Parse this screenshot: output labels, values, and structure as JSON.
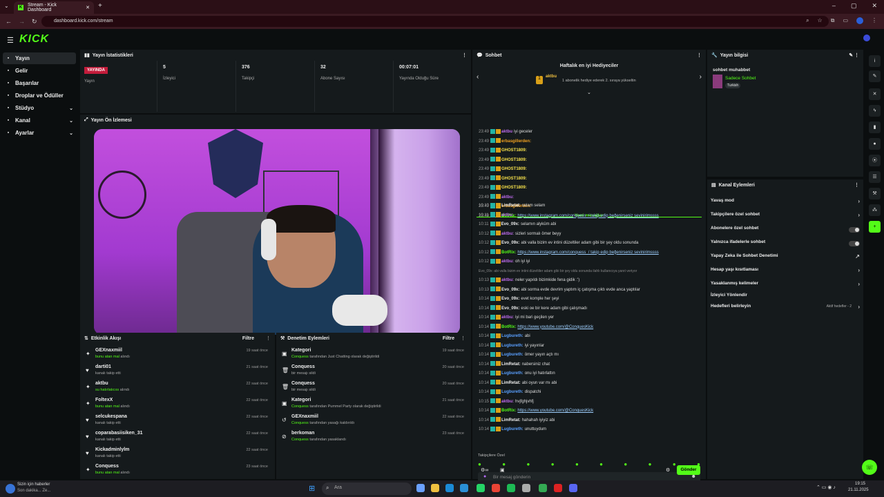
{
  "browser": {
    "tab_title": "Stream - Kick Dashboard",
    "url": "dashboard.kick.com/stream",
    "new_tab": "+",
    "window_controls": [
      "–",
      "▢",
      "✕"
    ]
  },
  "brand": {
    "logo": "KICK",
    "accent": "#53fc18",
    "live": "#c31c3b"
  },
  "sidebar": {
    "items": [
      {
        "label": "Yayın",
        "icon": "broadcast-icon",
        "active": true
      },
      {
        "label": "Gelir",
        "icon": "revenue-icon"
      },
      {
        "label": "Başarılar",
        "icon": "achievements-icon"
      },
      {
        "label": "Droplar ve Ödüller",
        "icon": "drops-icon"
      },
      {
        "label": "Stüdyo",
        "icon": "studio-icon",
        "chevron": "⌄"
      },
      {
        "label": "Kanal",
        "icon": "channel-icon",
        "chevron": "⌄"
      },
      {
        "label": "Ayarlar",
        "icon": "settings-icon",
        "chevron": "⌄"
      }
    ]
  },
  "stats": {
    "title": "Yayın İstatistikleri",
    "items": [
      {
        "value": "YAYINDA",
        "label": "Yayın",
        "badge": true
      },
      {
        "value": "5",
        "label": "İzleyici"
      },
      {
        "value": "376",
        "label": "Takipçi"
      },
      {
        "value": "32",
        "label": "Abone Sayısı"
      },
      {
        "value": "00:07:01",
        "label": "Yayında Olduğu Süre"
      }
    ]
  },
  "preview": {
    "title": "Yayın Ön İzlemesi"
  },
  "activity": {
    "title": "Etkinlik Akışı",
    "filter": "Filtre",
    "rows": [
      {
        "name": "GEXnaxmiil",
        "sub_hl": "bunu atan mal",
        "sub": "alındı",
        "time": "19 saat önce"
      },
      {
        "name": "darti01",
        "sub_hl": "",
        "sub": "kanalı takip etti",
        "time": "21 saat önce"
      },
      {
        "name": "aktbu",
        "sub_hl": "su hatırlatıcısı",
        "sub": "alındı",
        "time": "22 saat önce"
      },
      {
        "name": "FoltexX",
        "sub_hl": "bunu atan mal",
        "sub": "alındı",
        "time": "22 saat önce"
      },
      {
        "name": "selcukespana",
        "sub_hl": "",
        "sub": "kanalı takip etti",
        "time": "22 saat önce"
      },
      {
        "name": "coparabasiisiken_31",
        "sub_hl": "",
        "sub": "kanalı takip etti",
        "time": "22 saat önce"
      },
      {
        "name": "Kickadminlylm",
        "sub_hl": "",
        "sub": "kanalı takip etti",
        "time": "22 saat önce"
      },
      {
        "name": "Conquess",
        "sub_hl": "bunu atan mal",
        "sub": "alındı",
        "time": "23 saat önce"
      }
    ]
  },
  "moderation": {
    "title": "Denetim Eylemleri",
    "filter": "Filtre",
    "rows": [
      {
        "name": "Kategori",
        "sub_hl": "Conquess",
        "sub": "tarafından Just Chatting olarak değiştirildi",
        "time": "19 saat önce"
      },
      {
        "name": "Conquess",
        "sub_hl": "",
        "sub": "bir mesajı sildi",
        "time": "20 saat önce"
      },
      {
        "name": "Conquess",
        "sub_hl": "",
        "sub": "bir mesajı sildi",
        "time": "20 saat önce"
      },
      {
        "name": "Kategori",
        "sub_hl": "Conquess",
        "sub": "tarafından Pummel Party olarak değiştirildi",
        "time": "21 saat önce"
      },
      {
        "name": "GEXnaxmiil",
        "sub_hl": "Conquess",
        "sub": "tarafından yasağı kaldırıldı",
        "time": "22 saat önce"
      },
      {
        "name": "berkoman",
        "sub_hl": "Conquess",
        "sub": "tarafından yasaklandı",
        "time": "23 saat önce"
      }
    ]
  },
  "chat": {
    "title": "Sohbet",
    "gifters_title": "Haftalık en iyi Hediyeciler",
    "gifter_name": "aktbu",
    "gifter_rank": "1",
    "gifter_info": "1 abonelik hediye ederek 2. sıraya yükseltin",
    "new_messages": "Yeni mesajlar",
    "followers_only": "Takipçilere Özel",
    "input_placeholder": "Bir mesaj gönderin",
    "send": "Gönder",
    "messages_top": [
      {
        "t": "23:49",
        "u": "aktbu",
        "c": "#c06cf0",
        "m": "iyi geceler"
      },
      {
        "t": "23:49",
        "u": "erbasgillerden:",
        "c": "#f0a020",
        "m": ""
      },
      {
        "t": "23:49",
        "u": "GHOST1809:",
        "c": "#f5e04b",
        "m": ""
      },
      {
        "t": "23:49",
        "u": "GHOST1809:",
        "c": "#f5e04b",
        "m": ""
      },
      {
        "t": "23:49",
        "u": "GHOST1809:",
        "c": "#f5e04b",
        "m": ""
      },
      {
        "t": "23:49",
        "u": "GHOST1809:",
        "c": "#f5e04b",
        "m": ""
      },
      {
        "t": "23:49",
        "u": "GHOST1809:",
        "c": "#f5e04b",
        "m": ""
      },
      {
        "t": "23:49",
        "u": "aktbu:",
        "c": "#c06cf0",
        "m": ""
      },
      {
        "t": "23:49",
        "u": "erbasgillerden:",
        "c": "#f0a020",
        "m": ""
      },
      {
        "t": "23:49",
        "u": "BotRix:",
        "c": "#53fc18",
        "m": "https://www.instagram.com/conquess_/ takip edip beğenirseniz sevinirimssss"
      }
    ],
    "messages_new": [
      {
        "t": "10:10",
        "u": "LimRetat:",
        "c": "#eeeeee",
        "m": "selam selam"
      },
      {
        "t": "10:11",
        "u": "aktbu:",
        "c": "#c06cf0",
        "m": ""
      },
      {
        "t": "10:11",
        "u": "Evo_09x:",
        "c": "#eeeeee",
        "m": "selamın alyküm abi"
      },
      {
        "t": "10:12",
        "u": "aktbu:",
        "c": "#c06cf0",
        "m": "sizleri sormalı ömer beyy"
      },
      {
        "t": "10:12",
        "u": "Evo_09x:",
        "c": "#eeeeee",
        "m": "abi valla bizim ev intini düzeltiler adam gibi bir şey oldu sonunda"
      },
      {
        "t": "10:12",
        "u": "BotRix:",
        "c": "#53fc18",
        "m": "https://www.instagram.com/conquess_/ takip edip beğenirseniz sevinirimssss"
      },
      {
        "t": "10:12",
        "u": "aktbu:",
        "c": "#c06cf0",
        "m": "oh iyi iyi"
      },
      {
        "t": "",
        "u": "Evo_09x: abi valla bizim ev intini düzeltiler adam gibi bir şey oldu sonunda ilahlı kullanıcıya yanıt veriyor",
        "c": "#888888",
        "m": ""
      },
      {
        "t": "10:13",
        "u": "aktbu:",
        "c": "#c06cf0",
        "m": "neler yapıldı bizimkide fena gidik :')"
      },
      {
        "t": "10:13",
        "u": "Evo_09x:",
        "c": "#eeeeee",
        "m": "abi sorma evde devrim yaptım iç çatışma çıktı evde anca yaptılar"
      },
      {
        "t": "10:14",
        "u": "Evo_09x:",
        "c": "#eeeeee",
        "m": "evet komple her şeyi"
      },
      {
        "t": "10:14",
        "u": "Evo_09x:",
        "c": "#eeeeee",
        "m": "eski oe bir kere adam gibi çalışmadı"
      },
      {
        "t": "10:14",
        "u": "aktbu:",
        "c": "#c06cf0",
        "m": "iyi mi bari geçilen yer"
      },
      {
        "t": "10:14",
        "u": "BotRix:",
        "c": "#53fc18",
        "m": "https://www.youtube.com/@ConquesKick"
      },
      {
        "t": "10:14",
        "u": "Lugbureth:",
        "c": "#5aa0ff",
        "m": "abi"
      },
      {
        "t": "10:14",
        "u": "Lugbureth:",
        "c": "#5aa0ff",
        "m": "iyi yayınlar"
      },
      {
        "t": "10:14",
        "u": "Lugbureth:",
        "c": "#5aa0ff",
        "m": "ömer yayın açtı mı"
      },
      {
        "t": "10:14",
        "u": "LimRetat:",
        "c": "#eeeeee",
        "m": "nabersiniz chat"
      },
      {
        "t": "10:14",
        "u": "Lugbureth:",
        "c": "#5aa0ff",
        "m": "onu iyi hatırlattın"
      },
      {
        "t": "10:14",
        "u": "LimRetat:",
        "c": "#eeeeee",
        "m": "abi oyun var mı abi"
      },
      {
        "t": "10:14",
        "u": "Lugbureth:",
        "c": "#5aa0ff",
        "m": "dispatchi"
      },
      {
        "t": "10:15",
        "u": "aktbu:",
        "c": "#c06cf0",
        "m": "hvjfghjvhfj"
      },
      {
        "t": "10:14",
        "u": "BotRix:",
        "c": "#53fc18",
        "m": "https://www.youtube.com/@ConquesKick"
      },
      {
        "t": "10:14",
        "u": "LimRetat:",
        "c": "#eeeeee",
        "m": "hahahah iyiyiz abi"
      },
      {
        "t": "10:14",
        "u": "Lugbureth:",
        "c": "#5aa0ff",
        "m": "unuttuydum"
      }
    ]
  },
  "stream_info": {
    "title": "Yayın bilgisi",
    "stream_title": "sohbet muhabbet",
    "category": "Sadece Sohbet",
    "tag": "Turkish"
  },
  "channel_actions": {
    "title": "Kanal Eylemleri",
    "rows": [
      {
        "label": "Yavaş mod",
        "control": "arrow"
      },
      {
        "label": "Takipçilere özel sohbet",
        "control": "arrow"
      },
      {
        "label": "Abonelere özel sohbet",
        "control": "toggle"
      },
      {
        "label": "Yalnızca ifadelerle sohbet",
        "control": "toggle"
      },
      {
        "label": "Yapay Zeka ile Sohbet Denetimi",
        "control": "external"
      },
      {
        "label": "Hesap yaşı kısıtlaması",
        "control": "arrow"
      },
      {
        "label": "Yasaklanmış kelimeler",
        "control": "arrow"
      },
      {
        "label": "İzleyici Yönlendir",
        "control": "none"
      },
      {
        "label": "Hedefleri belirleyin",
        "control": "arrow",
        "extra": "Aktif hedefler - 2"
      }
    ]
  },
  "taskbar": {
    "news_title": "Sizin için haberler",
    "news_sub": "Son dakika... Ze...",
    "search_placeholder": "Ara",
    "time": "19:15",
    "date": "21.11.2025"
  }
}
